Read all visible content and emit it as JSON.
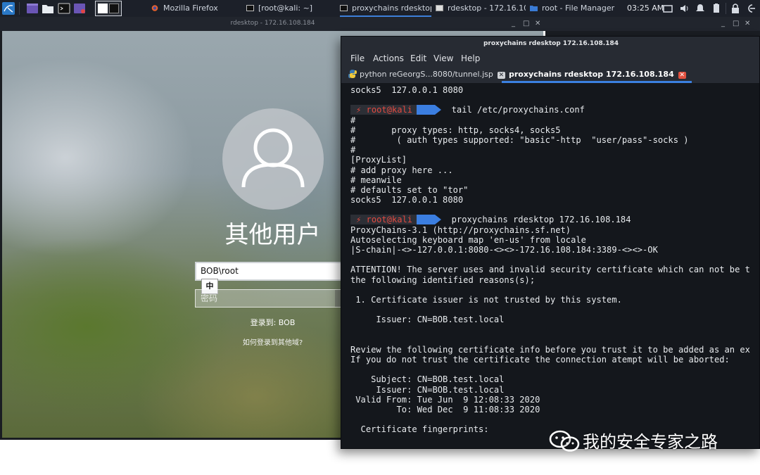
{
  "taskbar": {
    "tasks": [
      {
        "label": "Mozilla Firefox",
        "icon": "firefox-icon"
      },
      {
        "label": "[root@kali: ~]",
        "icon": "terminal-icon"
      },
      {
        "label": "proxychains rdesktop ...",
        "icon": "terminal-icon"
      },
      {
        "label": "rdesktop - 172.16.10...",
        "icon": "rdesktop-icon"
      },
      {
        "label": "root - File Manager",
        "icon": "folder-icon"
      }
    ],
    "clock": "03:25 AM"
  },
  "rdesktop": {
    "window_title": "rdesktop - 172.16.108.184",
    "login": {
      "user_title": "其他用户",
      "username_value": "BOB\\root",
      "ime_indicator": "中",
      "password_placeholder": "密码",
      "login_to": "登录到: BOB",
      "other_domain_link": "如何登录到其他域?"
    }
  },
  "terminal": {
    "window_title": "proxychains rdesktop 172.16.108.184",
    "menu": [
      "File",
      "Actions",
      "Edit",
      "View",
      "Help"
    ],
    "tabs": [
      {
        "label": "python reGeorgS...8080/tunnel.jsp",
        "active": false
      },
      {
        "label": "proxychains rdesktop 172.16.108.184",
        "active": true
      }
    ],
    "prompt_user": "⚡ root@kali",
    "lines": [
      {
        "text": "socks5  127.0.0.1 8080"
      },
      {
        "text": ""
      },
      {
        "prompt": true,
        "text": "tail /etc/proxychains.conf"
      },
      {
        "text": "#"
      },
      {
        "text": "#       proxy types: http, socks4, socks5"
      },
      {
        "text": "#        ( auth types supported: \"basic\"-http  \"user/pass\"-socks )"
      },
      {
        "text": "#"
      },
      {
        "text": "[ProxyList]"
      },
      {
        "text": "# add proxy here ..."
      },
      {
        "text": "# meanwile"
      },
      {
        "text": "# defaults set to \"tor\""
      },
      {
        "text": "socks5  127.0.0.1 8080"
      },
      {
        "text": ""
      },
      {
        "prompt": true,
        "text": "proxychains rdesktop 172.16.108.184"
      },
      {
        "text": "ProxyChains-3.1 (http://proxychains.sf.net)"
      },
      {
        "text": "Autoselecting keyboard map 'en-us' from locale"
      },
      {
        "text": "|S-chain|-<>-127.0.0.1:8080-<><>-172.16.108.184:3389-<><>-OK"
      },
      {
        "text": ""
      },
      {
        "text": "ATTENTION! The server uses and invalid security certificate which can not be t"
      },
      {
        "text": "the following identified reasons(s);"
      },
      {
        "text": ""
      },
      {
        "text": " 1. Certificate issuer is not trusted by this system."
      },
      {
        "text": ""
      },
      {
        "text": "     Issuer: CN=BOB.test.local"
      },
      {
        "text": ""
      },
      {
        "text": ""
      },
      {
        "text": "Review the following certificate info before you trust it to be added as an ex"
      },
      {
        "text": "If you do not trust the certificate the connection atempt will be aborted:"
      },
      {
        "text": ""
      },
      {
        "text": "    Subject: CN=BOB.test.local"
      },
      {
        "text": "     Issuer: CN=BOB.test.local"
      },
      {
        "text": " Valid From: Tue Jun  9 12:08:33 2020"
      },
      {
        "text": "         To: Wed Dec  9 11:08:33 2020"
      },
      {
        "text": ""
      },
      {
        "text": "  Certificate fingerprints:"
      }
    ]
  },
  "watermark": {
    "text": "我的安全专家之路",
    "icon": "wechat-icon"
  },
  "colors": {
    "taskbar_bg": "#1c2029",
    "terminal_bg": "#14171c",
    "prompt_user": "#e34a40",
    "prompt_accent": "#3b7ee0",
    "active_tab_underline": "#3b80e0"
  }
}
